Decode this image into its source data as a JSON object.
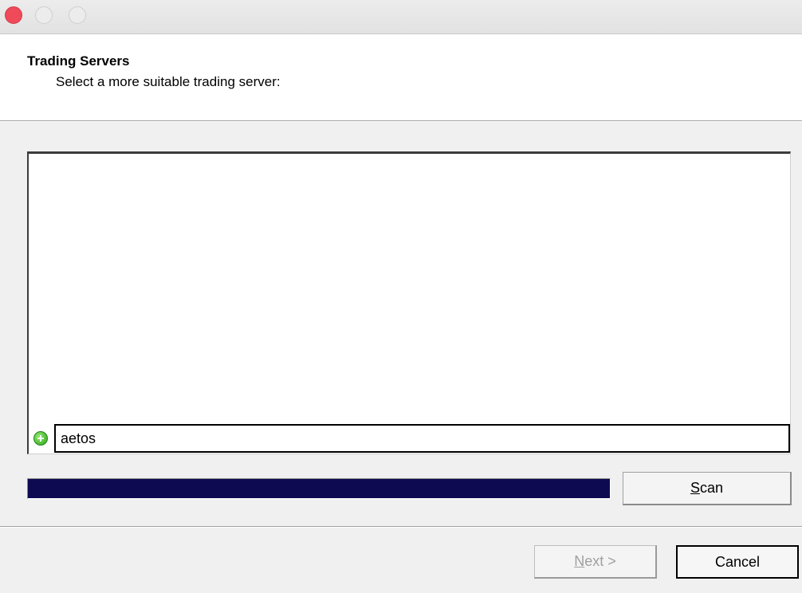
{
  "window": {
    "controls": [
      "close-button",
      "minimize-button",
      "maximize-button"
    ],
    "control_colors": {
      "close": "#ee4a5a",
      "minimize": "#ececec",
      "maximize": "#ececec"
    }
  },
  "header": {
    "title": "Trading Servers",
    "subtitle": "Select a more suitable trading server:"
  },
  "server_list": {
    "add_icon": "add-icon",
    "input_value": "aetos"
  },
  "progress": {
    "fraction": 1.0,
    "fill_color": "#0d0a52"
  },
  "buttons": {
    "scan_mnemonic": "S",
    "scan_rest": "can",
    "next_mnemonic": "N",
    "next_rest": "ext >",
    "cancel_label": "Cancel"
  }
}
